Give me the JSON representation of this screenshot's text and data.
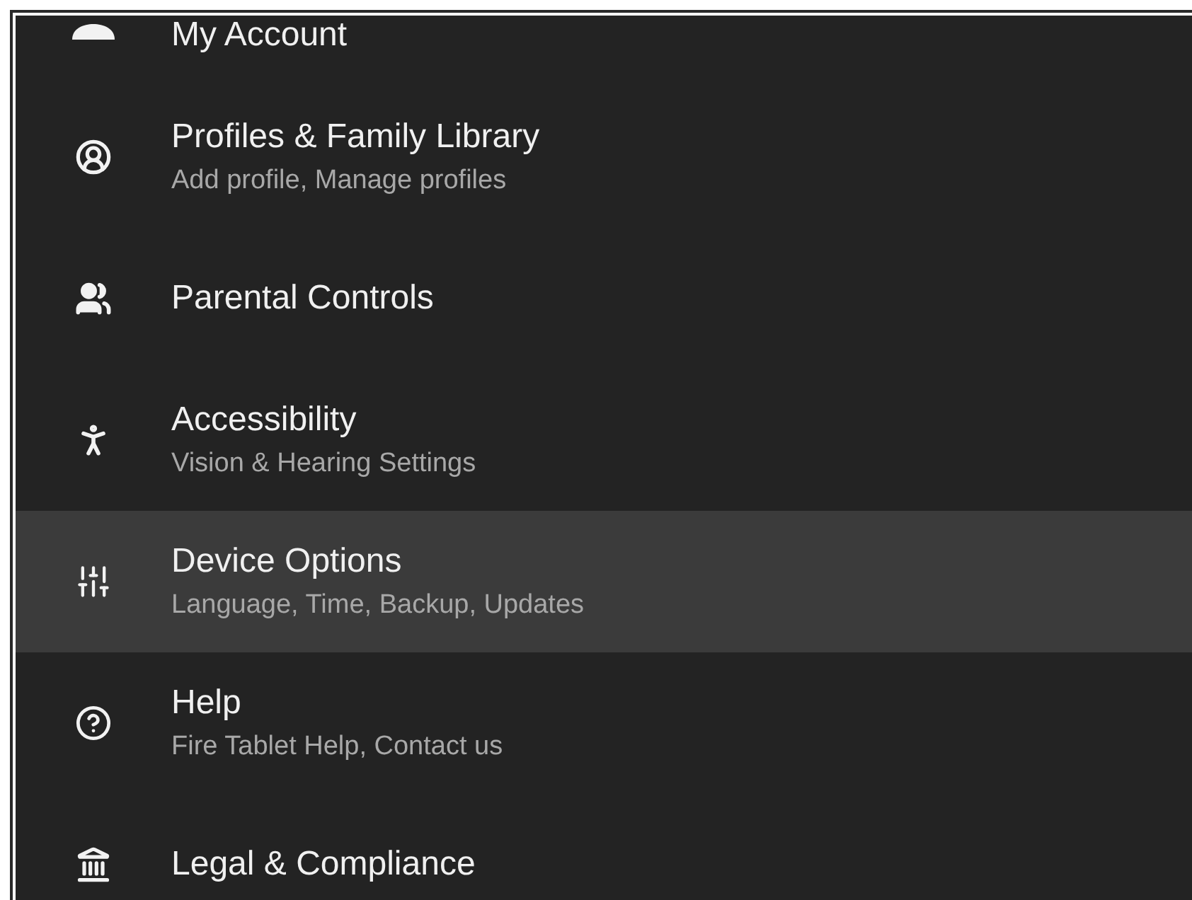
{
  "settings": [
    {
      "title": "My Account",
      "selected": false
    },
    {
      "title": "Profiles & Family Library",
      "subtitle": "Add profile, Manage profiles",
      "selected": false
    },
    {
      "title": "Parental Controls",
      "selected": false
    },
    {
      "title": "Accessibility",
      "subtitle": "Vision & Hearing Settings",
      "selected": false
    },
    {
      "title": "Device Options",
      "subtitle": "Language, Time, Backup, Updates",
      "selected": true
    },
    {
      "title": "Help",
      "subtitle": "Fire Tablet Help, Contact us",
      "selected": false
    },
    {
      "title": "Legal & Compliance",
      "selected": false
    }
  ]
}
